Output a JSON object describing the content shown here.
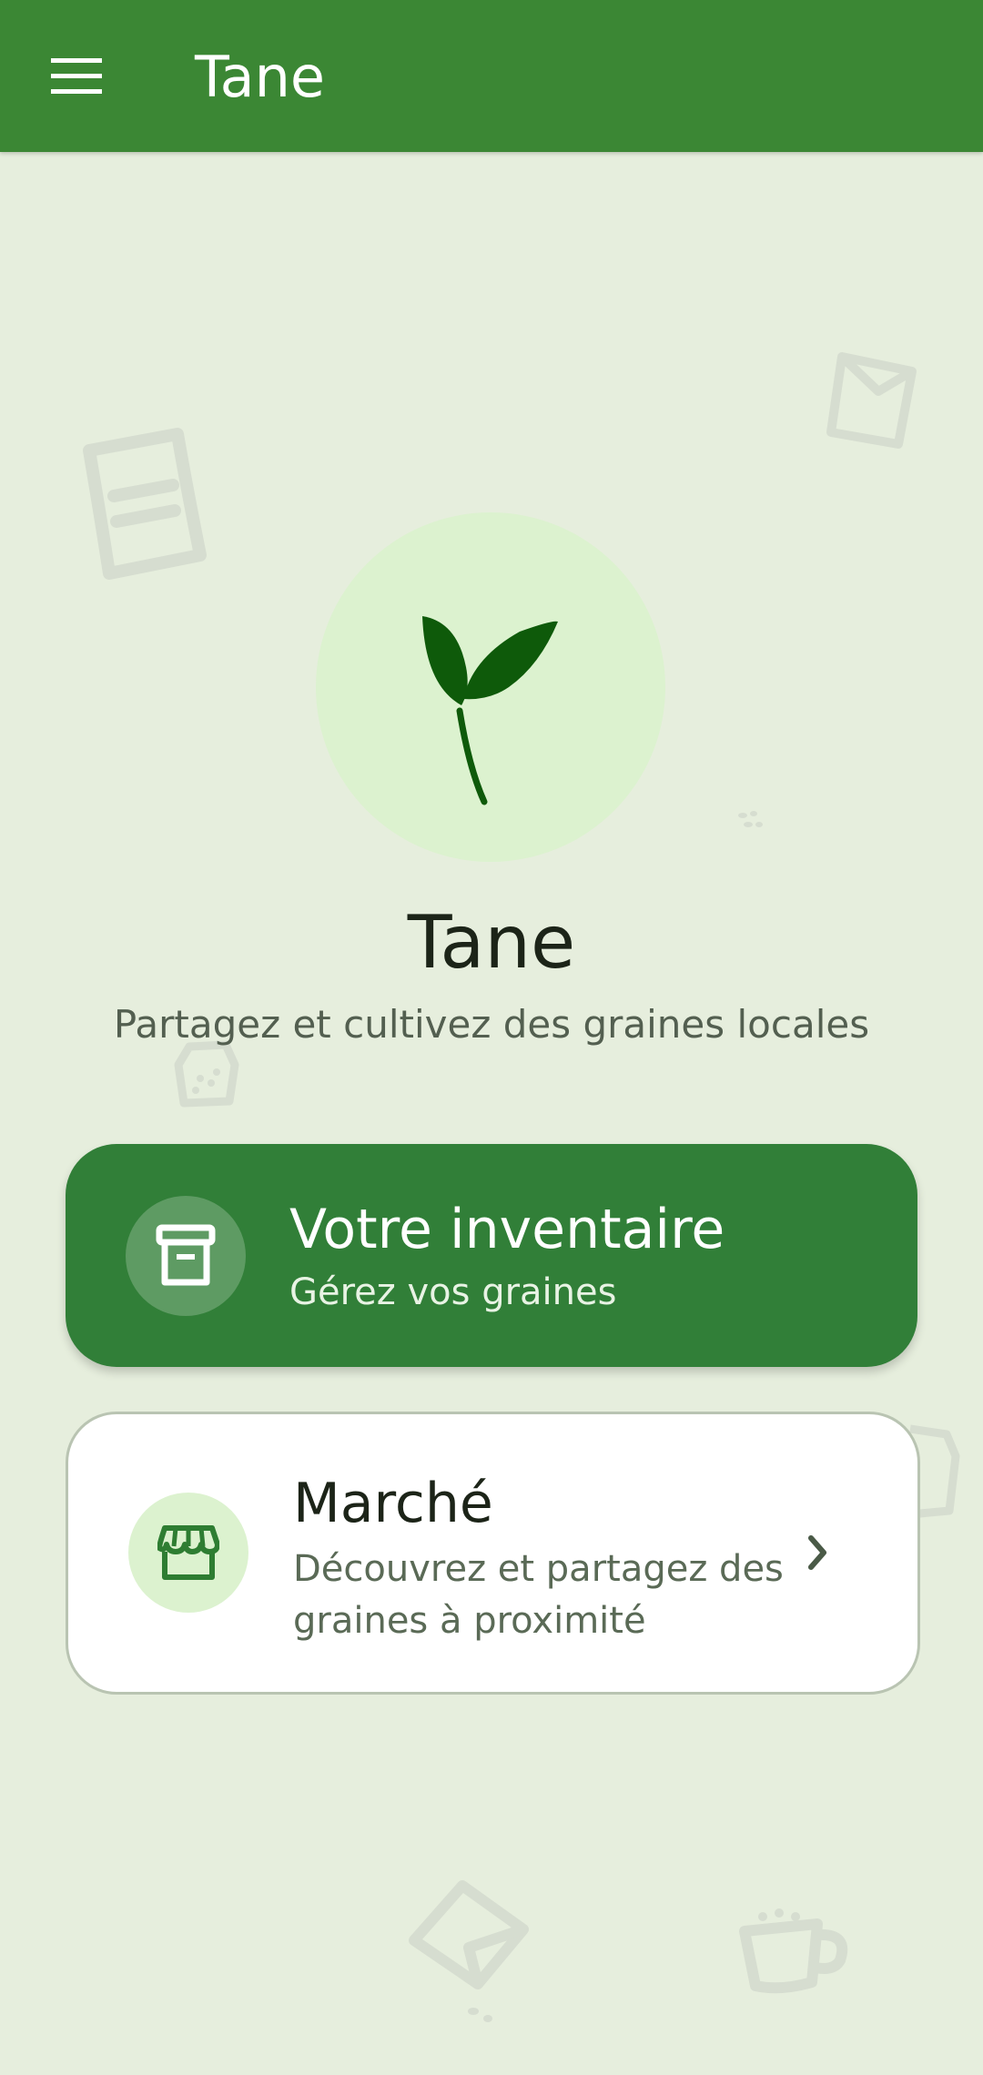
{
  "app_bar": {
    "title": "Tane",
    "menu_icon": "hamburger-menu-icon"
  },
  "hero": {
    "icon": "sprout-icon",
    "title": "Tane",
    "subtitle": "Partagez et cultivez des graines locales"
  },
  "cards": {
    "inventory": {
      "icon": "archive-box-icon",
      "title": "Votre inventaire",
      "subtitle": "Gérez vos graines"
    },
    "market": {
      "icon": "storefront-icon",
      "title": "Marché",
      "description": "Découvrez et partagez des graines à proximité",
      "trailing_icon": "chevron-right-icon"
    }
  },
  "colors": {
    "app_bar": "#3B8734",
    "background": "#E6EEDD",
    "primary_card": "#317F38",
    "icon_tint_light": "#DCF2CF",
    "sprout": "#0E5A0A"
  }
}
